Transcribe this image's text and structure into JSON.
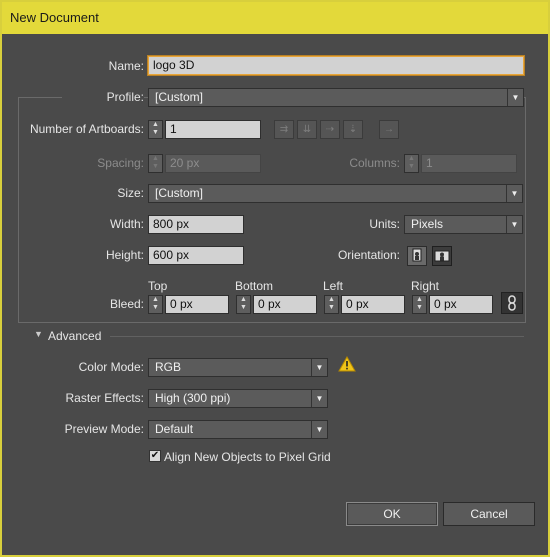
{
  "window": {
    "title": "New Document"
  },
  "name": {
    "label": "Name:",
    "value": "logo 3D"
  },
  "profile": {
    "label": "Profile:",
    "value": "[Custom]"
  },
  "artboards": {
    "label": "Number of Artboards:",
    "value": "1"
  },
  "spacing": {
    "label": "Spacing:",
    "value": "20 px"
  },
  "columns": {
    "label": "Columns:",
    "value": "1"
  },
  "size": {
    "label": "Size:",
    "value": "[Custom]"
  },
  "width": {
    "label": "Width:",
    "value": "800 px"
  },
  "units": {
    "label": "Units:",
    "value": "Pixels"
  },
  "height": {
    "label": "Height:",
    "value": "600 px"
  },
  "orientation": {
    "label": "Orientation:",
    "selected": "landscape"
  },
  "bleed": {
    "label": "Bleed:",
    "top": {
      "label": "Top",
      "value": "0 px"
    },
    "bottom": {
      "label": "Bottom",
      "value": "0 px"
    },
    "left": {
      "label": "Left",
      "value": "0 px"
    },
    "right": {
      "label": "Right",
      "value": "0 px"
    }
  },
  "advanced": {
    "label": "Advanced",
    "color_mode": {
      "label": "Color Mode:",
      "value": "RGB"
    },
    "raster_effects": {
      "label": "Raster Effects:",
      "value": "High (300 ppi)"
    },
    "preview_mode": {
      "label": "Preview Mode:",
      "value": "Default"
    },
    "align_pixel_grid": {
      "label": "Align New Objects to Pixel Grid",
      "checked": true
    }
  },
  "buttons": {
    "ok": "OK",
    "cancel": "Cancel"
  },
  "icons": {
    "warning": "warning-icon",
    "link": "link-chain-icon",
    "collapse": "triangle-down-icon"
  },
  "colors": {
    "title_bar": "#e3d93a",
    "dialog_bg": "#4a4a4a",
    "focus": "#e7a53a",
    "warning": "#f0c419"
  }
}
